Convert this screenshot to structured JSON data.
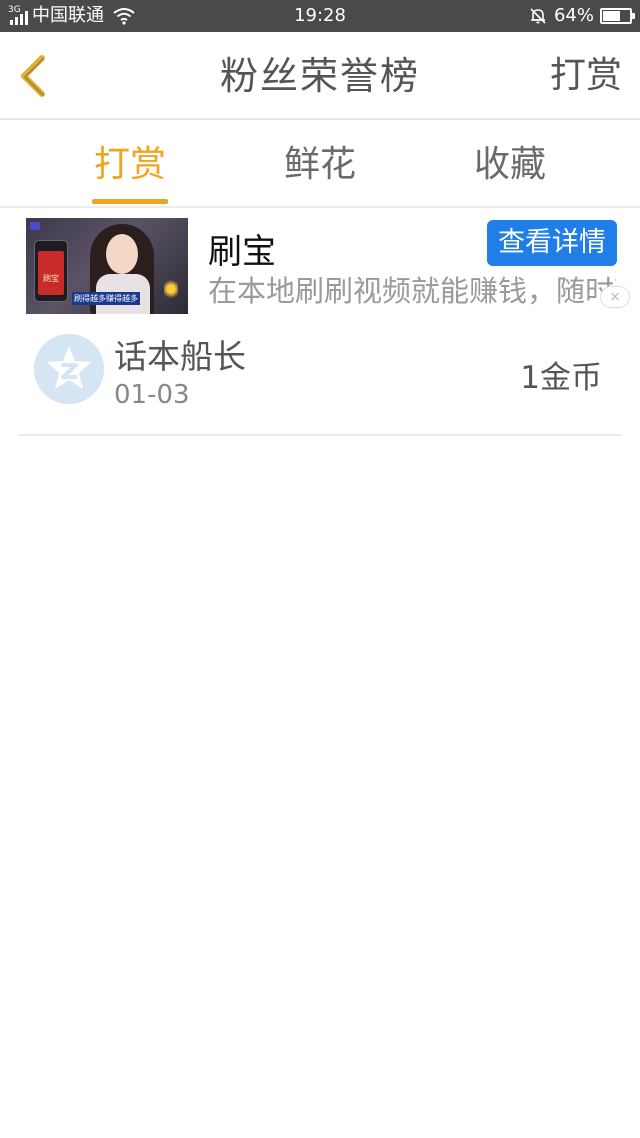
{
  "status_bar": {
    "network": "3G",
    "carrier": "中国联通",
    "time": "19:28",
    "battery_percent_text": "64%",
    "battery_level": 0.64,
    "icons": [
      "signal-icon",
      "wifi-icon",
      "bell-off-icon",
      "battery-icon"
    ]
  },
  "header": {
    "title": "粉丝荣誉榜",
    "action_label": "打赏",
    "back_icon": "chevron-left-icon",
    "back_color": "#e0b13a"
  },
  "tabs": [
    {
      "label": "打赏",
      "active": true
    },
    {
      "label": "鲜花",
      "active": false
    },
    {
      "label": "收藏",
      "active": false
    }
  ],
  "ad": {
    "title": "刷宝",
    "button_label": "查看详情",
    "description": "在本地刷刷视频就能赚钱，随时可以提现",
    "thumb_phone_label": "刷宝",
    "thumb_caption": "刷得越多赚得越多",
    "close_glyph": "×",
    "button_color": "#1f7ee8"
  },
  "rank_list": [
    {
      "name": "话本船长",
      "date": "01-03",
      "amount": "1金币",
      "avatar_icon": "default-avatar-icon"
    }
  ],
  "colors": {
    "accent": "#f0a51e",
    "status_bar_bg": "#4a4a4a",
    "text_primary": "#555555"
  }
}
